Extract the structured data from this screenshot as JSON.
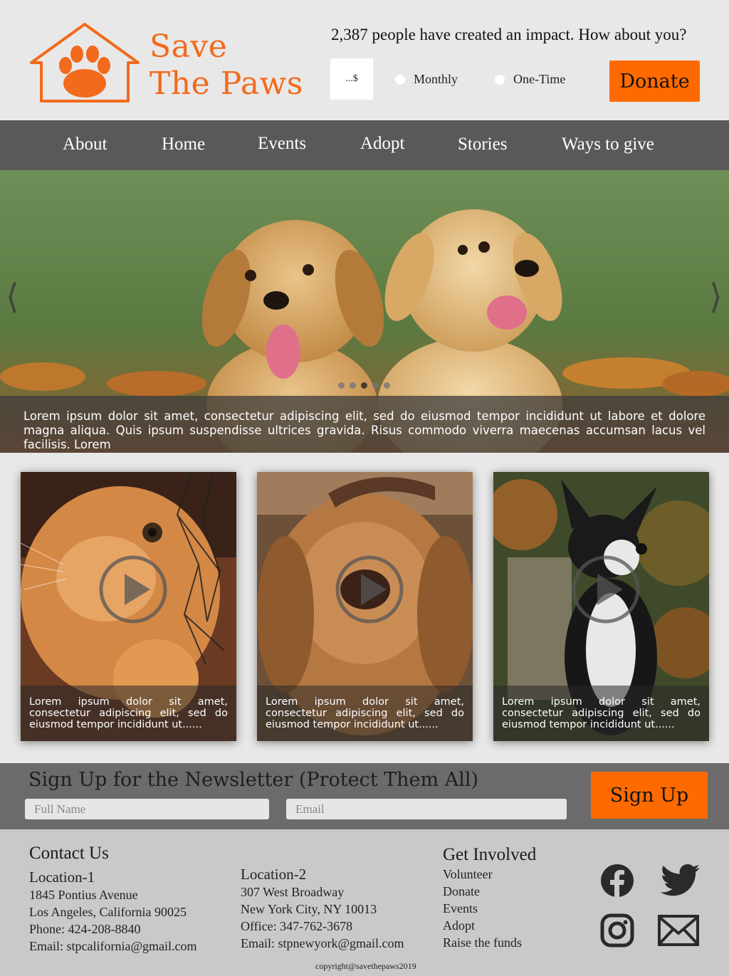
{
  "brand": {
    "line1": "Save",
    "line2": "The Paws"
  },
  "impact_text": "2,387 people have created an impact. How about you?",
  "donation": {
    "amount_placeholder": "...$",
    "frequency_options": [
      "Monthly",
      "One-Time"
    ],
    "donate_label": "Donate"
  },
  "nav": {
    "items": [
      "About",
      "Home",
      "Events",
      "Adopt",
      "Stories",
      "Ways to give"
    ]
  },
  "hero": {
    "prev_arrow": "⟨",
    "next_arrow": "⟩",
    "slide_count": 5,
    "active_slide": 3,
    "caption": "Lorem ipsum dolor sit amet, consectetur adipiscing elit, sed do eiusmod tempor incididunt ut labore et dolore magna aliqua. Quis ipsum suspendisse ultrices gravida. Risus commodo viverra maecenas accumsan lacus vel facilisis. Lorem"
  },
  "cards": [
    {
      "caption": "Lorem ipsum dolor sit amet, consectetur adipiscing elit, sed do eiusmod tempor incididunt ut......"
    },
    {
      "caption": "Lorem ipsum dolor sit amet, consectetur adipiscing elit, sed do eiusmod tempor incididunt ut......"
    },
    {
      "caption": "Lorem ipsum dolor sit amet, consectetur adipiscing elit, sed do eiusmod tempor incididunt ut......"
    }
  ],
  "newsletter": {
    "title": "Sign Up for the Newsletter (Protect Them All)",
    "name_placeholder": "Full Name",
    "email_placeholder": "Email",
    "signup_label": "Sign Up"
  },
  "footer": {
    "contact_title": "Contact Us",
    "location1": {
      "title": "Location-1",
      "lines": [
        "1845 Pontius Avenue",
        "Los Angeles, California 90025",
        "Phone: 424-208-8840",
        "Email: stpcalifornia@gmail.com"
      ]
    },
    "location2": {
      "title": "Location-2",
      "lines": [
        "307 West Broadway",
        "New York City, NY 10013",
        "Office: 347-762-3678",
        "Email: stpnewyork@gmail.com"
      ]
    },
    "get_involved": {
      "title": "Get Involved",
      "links": [
        "Volunteer",
        "Donate",
        "Events",
        "Adopt",
        "Raise the funds"
      ]
    },
    "social_icons": [
      "facebook-icon",
      "twitter-icon",
      "instagram-icon",
      "mail-icon"
    ],
    "copyright": "copyright@savethepaws2019"
  },
  "colors": {
    "accent": "#ff6a00",
    "brand": "#f26a1b",
    "nav_bg": "#595959",
    "newsletter_bg": "#6b6b6b",
    "footer_bg": "#c9c9c9"
  }
}
